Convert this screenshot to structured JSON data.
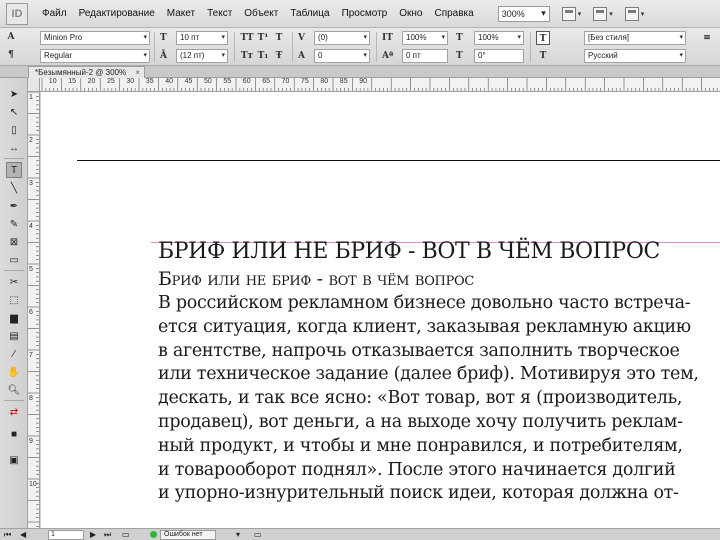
{
  "app": {
    "logo": "ID"
  },
  "menu": {
    "items": [
      "Файл",
      "Редактирование",
      "Макет",
      "Текст",
      "Объект",
      "Таблица",
      "Просмотр",
      "Окно",
      "Справка"
    ],
    "zoom": "300%"
  },
  "control": {
    "font_family": "Minion Pro",
    "font_style": "Regular",
    "font_size": "10 пт",
    "leading": "(12 пт)",
    "kerning": "(0)",
    "tracking": "0",
    "vscale": "100%",
    "hscale": "100%",
    "baseline": "0 пт",
    "skew": "0°",
    "char_style": "[Без стиля]",
    "language": "Русский"
  },
  "document": {
    "tab_title": "*Безымянный-2 @ 300%",
    "tab_close": "×",
    "heading1": "БРИФ ИЛИ НЕ БРИФ - ВОТ В ЧЁМ ВОПРОС",
    "heading2": "Бриф или не бриф - вот в чём вопрос",
    "lines": [
      "В российском рекламном бизнесе довольно часто встреча-",
      "ется ситуация, когда клиент, заказывая рекламную акцию",
      "в агентстве, напрочь отказывается заполнить творческое",
      "или техническое задание (далее бриф). Мотивируя это тем,",
      "дескать, и так все ясно: «Вот товар, вот я (производитель,",
      "продавец), вот деньги, а на выходе хочу получить реклам-",
      "ный продукт, и чтобы и мне понравился, и потребителям,",
      "и товарооборот поднял». После этого начинается долгий",
      "и упорно-изнурительный поиск идеи, которая должна от-"
    ]
  },
  "ruler": {
    "h_labels": [
      "10",
      "15",
      "20",
      "25",
      "30",
      "35",
      "40",
      "45",
      "50",
      "55",
      "60",
      "65",
      "70",
      "75",
      "80",
      "85",
      "90"
    ],
    "v_labels": [
      "1",
      "2",
      "3",
      "4",
      "5",
      "6",
      "7",
      "8",
      "9",
      "10"
    ]
  },
  "status": {
    "page": "1",
    "errors": "Ошибок нет"
  }
}
